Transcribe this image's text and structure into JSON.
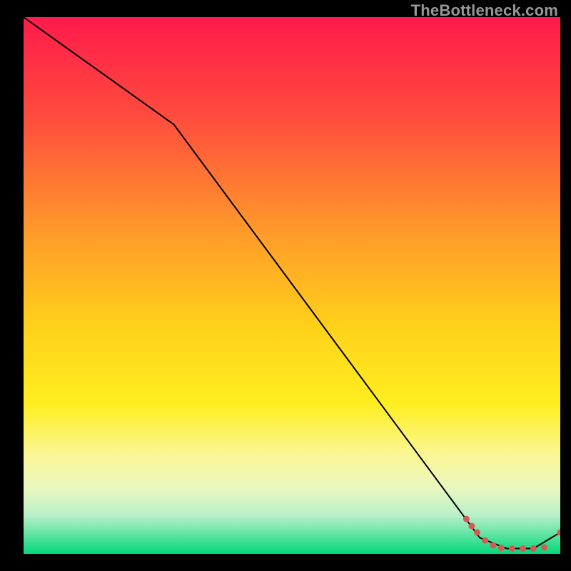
{
  "watermark": "TheBottleneck.com",
  "chart_data": {
    "type": "line",
    "title": "",
    "xlabel": "",
    "ylabel": "",
    "xlim": [
      0,
      100
    ],
    "ylim": [
      0,
      100
    ],
    "background_gradient": {
      "stops": [
        {
          "offset": 0.0,
          "color": "#ff1b4a"
        },
        {
          "offset": 0.18,
          "color": "#ff4a3e"
        },
        {
          "offset": 0.4,
          "color": "#ff9a2a"
        },
        {
          "offset": 0.58,
          "color": "#ffd21a"
        },
        {
          "offset": 0.72,
          "color": "#ffee20"
        },
        {
          "offset": 0.82,
          "color": "#faf79a"
        },
        {
          "offset": 0.88,
          "color": "#e8f7c2"
        },
        {
          "offset": 0.93,
          "color": "#b6f0c8"
        },
        {
          "offset": 0.97,
          "color": "#4ee29a"
        },
        {
          "offset": 1.0,
          "color": "#00d878"
        }
      ]
    },
    "series": [
      {
        "name": "bottleneck-curve",
        "stroke": "#000000",
        "stroke_width": 2,
        "x": [
          0,
          28,
          85,
          90,
          95,
          100
        ],
        "y": [
          100,
          80,
          3,
          1,
          1,
          4
        ]
      }
    ],
    "markers": {
      "name": "highlight-markers",
      "color": "#d45a52",
      "radius": 4.5,
      "points": [
        {
          "x": 82.5,
          "y": 6.5
        },
        {
          "x": 83.5,
          "y": 5.2
        },
        {
          "x": 84.5,
          "y": 4.0
        },
        {
          "x": 86.0,
          "y": 2.5
        },
        {
          "x": 87.5,
          "y": 1.6
        },
        {
          "x": 89.0,
          "y": 1.1
        },
        {
          "x": 91.0,
          "y": 1.0
        },
        {
          "x": 93.0,
          "y": 1.0
        },
        {
          "x": 95.0,
          "y": 1.0
        },
        {
          "x": 97.0,
          "y": 1.2
        },
        {
          "x": 100.0,
          "y": 4.0
        }
      ]
    }
  }
}
